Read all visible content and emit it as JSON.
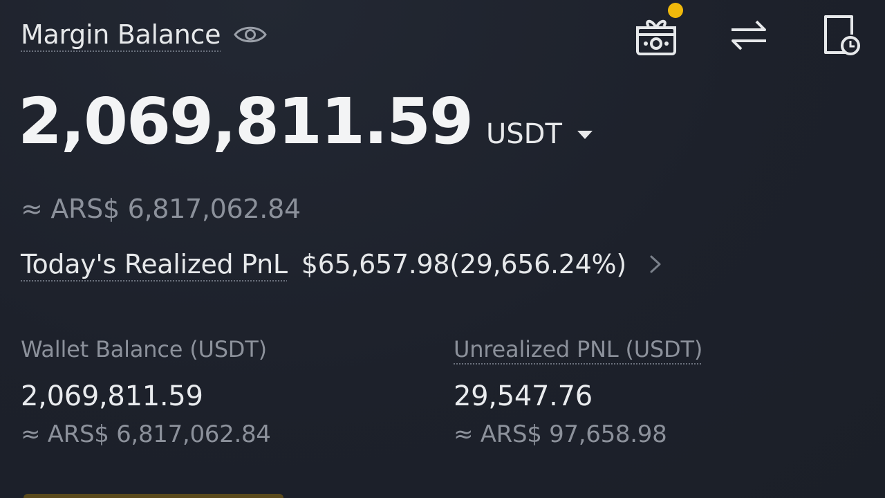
{
  "header": {
    "title": "Margin Balance",
    "eye_icon": "eye-icon",
    "actions": [
      {
        "name": "gift-icon",
        "has_notification": true
      },
      {
        "name": "transfer-icon"
      },
      {
        "name": "history-icon"
      }
    ]
  },
  "balance": {
    "value": "2,069,811.59",
    "unit": "USDT",
    "approx": "≈ ARS$ 6,817,062.84"
  },
  "pnl": {
    "label": "Today's Realized PnL",
    "value": "$65,657.98(29,656.24%)"
  },
  "wallet": {
    "label": "Wallet Balance (USDT)",
    "value": "2,069,811.59",
    "approx": "≈ ARS$ 6,817,062.84"
  },
  "unrealized": {
    "label": "Unrealized PNL (USDT)",
    "value": "29,547.76",
    "approx": "≈ ARS$ 97,658.98"
  },
  "colors": {
    "background": "#1e222c",
    "accent": "#f0b90b",
    "text_primary": "#eaecef",
    "text_secondary": "#8c919b"
  }
}
